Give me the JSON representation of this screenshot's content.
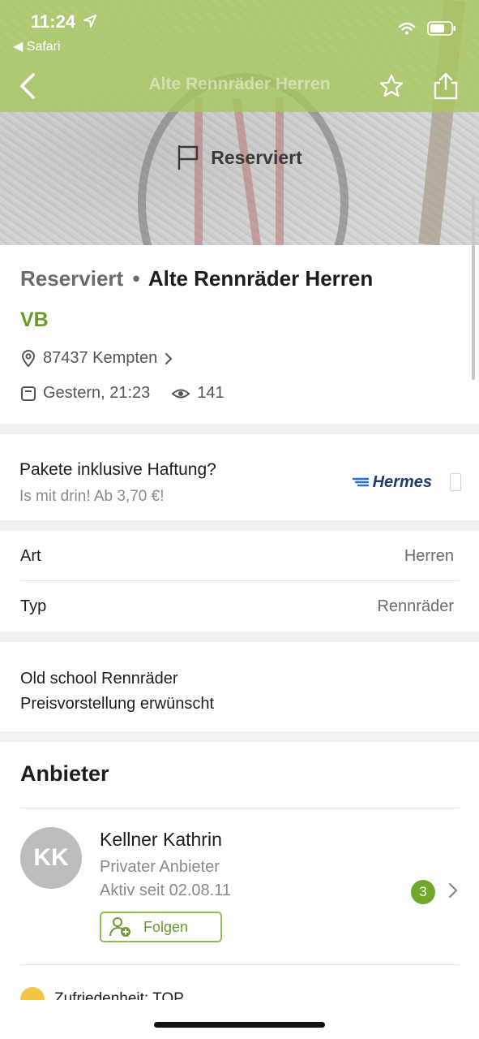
{
  "status_bar": {
    "time": "11:24",
    "back_app": "Safari"
  },
  "nav": {
    "title": "Alte Rennräder Herren"
  },
  "hero": {
    "banner_text": "Reserviert"
  },
  "listing": {
    "status": "Reserviert",
    "separator": "•",
    "title": "Alte Rennräder Herren",
    "price": "VB",
    "location": "87437 Kempten",
    "date": "Gestern, 21:23",
    "views": "141"
  },
  "promo": {
    "title": "Pakete inklusive Haftung?",
    "subtitle": "Is mit drin! Ab 3,70 €!",
    "brand": "Hermes"
  },
  "attributes": [
    {
      "label": "Art",
      "value": "Herren"
    },
    {
      "label": "Typ",
      "value": "Rennräder"
    }
  ],
  "description": {
    "line1": "Old school Rennräder",
    "line2": "Preisvorstellung erwünscht"
  },
  "seller": {
    "section_title": "Anbieter",
    "initials": "KK",
    "name": "Kellner Kathrin",
    "type": "Privater Anbieter",
    "since": "Aktiv seit 02.08.11",
    "count": "3",
    "follow_label": "Folgen",
    "peek_text": "Zufriedenheit: TOP"
  },
  "colors": {
    "brand_green": "#6ea92c",
    "topbar": "#a6c85a",
    "price_green": "#6c9a2a"
  }
}
